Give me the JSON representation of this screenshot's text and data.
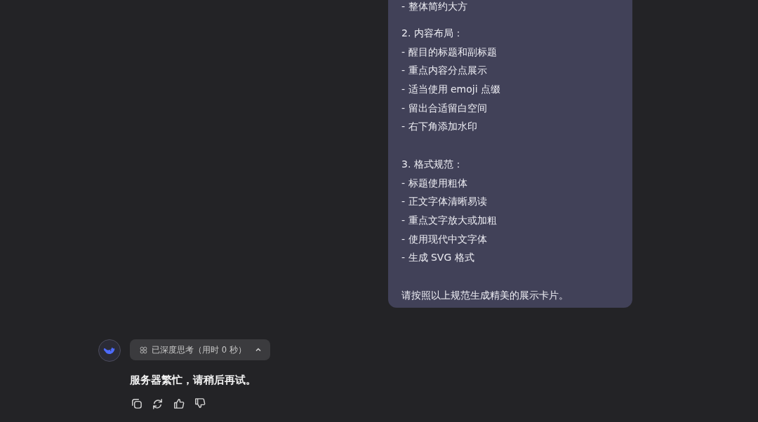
{
  "user_message": {
    "paragraphs": [
      [
        "- 整体简约大方"
      ],
      [
        "2. 内容布局：",
        "- 醒目的标题和副标题",
        "- 重点内容分点展示",
        "- 适当使用 emoji 点缀",
        "- 留出合适留白空间",
        "- 右下角添加水印"
      ],
      [
        "3. 格式规范：",
        "- 标题使用粗体",
        "- 正文字体清晰易读",
        "- 重点文字放大或加粗",
        "- 使用现代中文字体",
        "- 生成 SVG 格式"
      ],
      [
        "请按照以上规范生成精美的展示卡片。"
      ]
    ]
  },
  "assistant_message": {
    "thinking_label": "已深度思考（用时 0 秒）",
    "reply": "服务器繁忙，请稍后再试。",
    "actions": [
      {
        "kind": "copy"
      },
      {
        "kind": "regenerate"
      },
      {
        "kind": "like"
      },
      {
        "kind": "dislike"
      }
    ]
  }
}
